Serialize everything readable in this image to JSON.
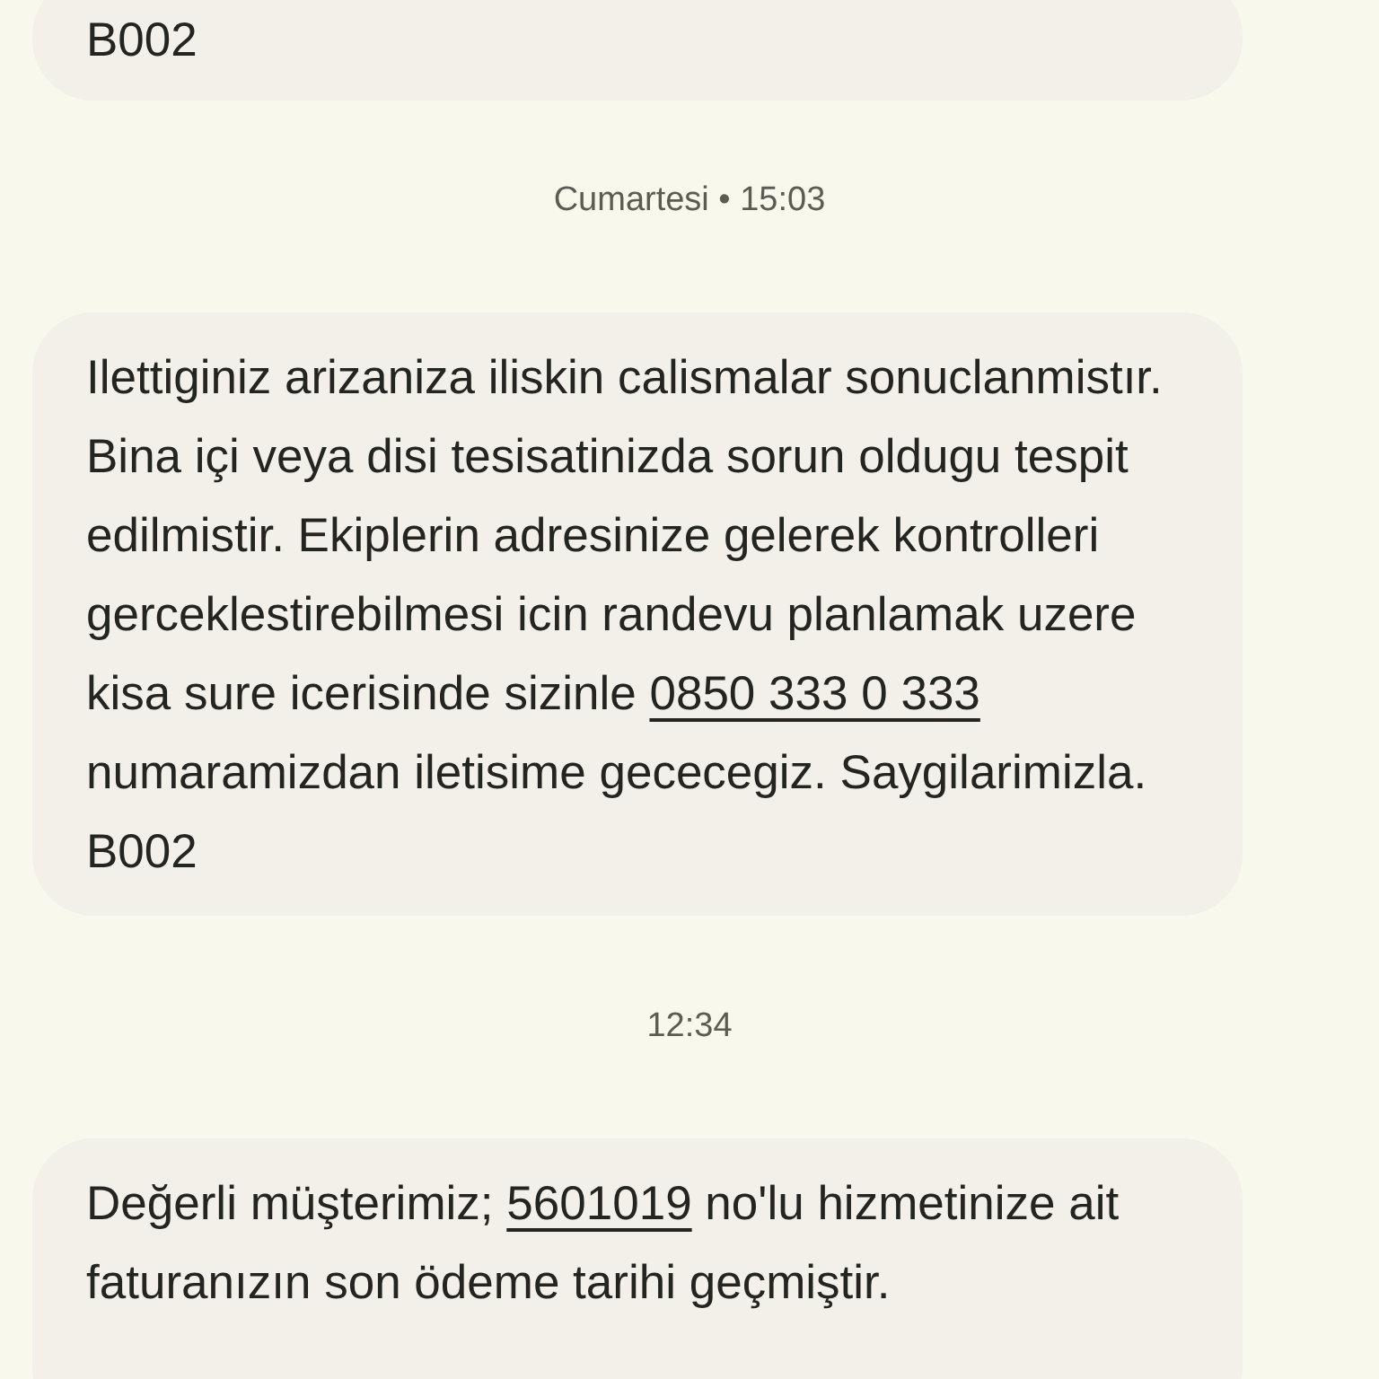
{
  "messages": [
    {
      "kind": "message",
      "parts": [
        {
          "kind": "text",
          "text": "B002"
        }
      ]
    },
    {
      "kind": "timestamp",
      "text": "Cumartesi • 15:03"
    },
    {
      "kind": "message",
      "parts": [
        {
          "kind": "text",
          "text": "Ilettiginiz arizaniza iliskin calismalar sonuclanmistır. Bina içi veya disi tesisatinizda sorun oldugu tespit edilmistir. Ekiplerin adresinize gelerek kontrolleri gerceklestirebilmesi icin randevu planlamak uzere kisa sure icerisinde sizinle "
        },
        {
          "kind": "link",
          "text": "0850 333 0 333"
        },
        {
          "kind": "text",
          "text": " numaramizdan iletisime gececegiz. Saygilarimizla. B002"
        }
      ]
    },
    {
      "kind": "timestamp",
      "text": "12:34"
    },
    {
      "kind": "message",
      "parts": [
        {
          "kind": "text",
          "text": "Değerli müşterimiz; "
        },
        {
          "kind": "link",
          "text": "5601019"
        },
        {
          "kind": "text",
          "text": " no'lu hizmetinize ait faturanızın son ödeme tarihi geçmiştir."
        }
      ]
    }
  ]
}
